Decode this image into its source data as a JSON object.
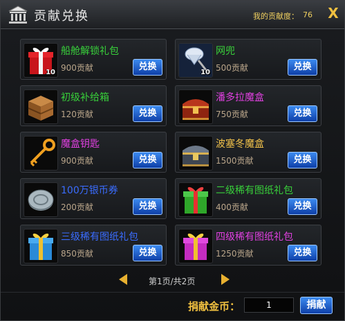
{
  "window": {
    "title": "贡献兑换",
    "contribution_label": "我的贡献度：",
    "contribution_value": "76",
    "close_glyph": "X"
  },
  "items": [
    {
      "name": "船舱解锁礼包",
      "cost": "900贡献",
      "qty": "10",
      "button": "兑换",
      "name_color": "#38d03a",
      "icon": "red-gift-icon"
    },
    {
      "name": "网兜",
      "cost": "500贡献",
      "qty": "10",
      "button": "兑换",
      "name_color": "#38d03a",
      "icon": "net-icon"
    },
    {
      "name": "初级补给箱",
      "cost": "120贡献",
      "qty": "",
      "button": "兑换",
      "name_color": "#38d03a",
      "icon": "wooden-crate-icon"
    },
    {
      "name": "潘多拉魔盒",
      "cost": "750贡献",
      "qty": "",
      "button": "兑换",
      "name_color": "#e040e0",
      "icon": "red-chest-icon"
    },
    {
      "name": "魔盒钥匙",
      "cost": "900贡献",
      "qty": "",
      "button": "兑换",
      "name_color": "#e040e0",
      "icon": "golden-key-icon"
    },
    {
      "name": "波塞冬魔盒",
      "cost": "1500贡献",
      "qty": "",
      "button": "兑换",
      "name_color": "#f2c24a",
      "icon": "silver-chest-icon"
    },
    {
      "name": "100万银币券",
      "cost": "200贡献",
      "qty": "",
      "button": "兑换",
      "name_color": "#3a6cff",
      "icon": "silver-coin-icon"
    },
    {
      "name": "二级稀有图纸礼包",
      "cost": "400贡献",
      "qty": "",
      "button": "兑换",
      "name_color": "#38d03a",
      "icon": "green-gift-icon"
    },
    {
      "name": "三级稀有图纸礼包",
      "cost": "850贡献",
      "qty": "",
      "button": "兑换",
      "name_color": "#3a6cff",
      "icon": "blue-gift-icon"
    },
    {
      "name": "四级稀有图纸礼包",
      "cost": "1250贡献",
      "qty": "",
      "button": "兑换",
      "name_color": "#e040e0",
      "icon": "purple-gift-icon"
    }
  ],
  "pager": {
    "text": "第1页/共2页",
    "current_page": 1,
    "total_pages": 2
  },
  "donate": {
    "label": "捐献金币：",
    "input_value": "1",
    "button": "捐献"
  }
}
